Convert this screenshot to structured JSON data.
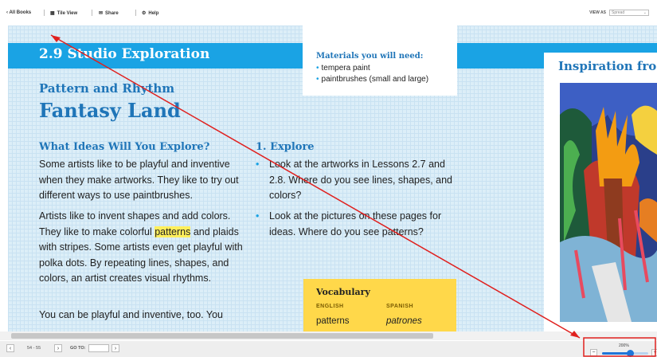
{
  "toolbar": {
    "all_books": "‹ All Books",
    "tile_view": "Tile View",
    "share": "Share",
    "help": "Help",
    "view_as_label": "VIEW AS",
    "view_as_value": "Spread"
  },
  "page": {
    "banner_title": "2.9 Studio Exploration",
    "materials_title": "Materials you will need:",
    "materials": [
      "tempera paint",
      "paintbrushes (small and large)"
    ],
    "subtitle": "Pattern and Rhythm",
    "title": "Fantasy Land",
    "ideas_heading": "What Ideas Will You Explore?",
    "para1": "Some artists like to be playful and inventive when they make artworks. They like to try out different ways to use paintbrushes.",
    "para2_a": "Artists like to invent shapes and add colors. They like to make colorful ",
    "para2_hl": "patterns",
    "para2_b": " and plaids with stripes. Some artists even get playful with polka dots. By repeating lines, shapes, and colors, an artist creates visual rhythms.",
    "para3": "You can be playful and inventive, too. You",
    "explore_heading": "1. Explore",
    "explore_items": [
      "Look at the artworks in Lessons 2.7 and 2.8. Where do you see lines, shapes, and colors?",
      "Look at the pictures on these pages for ideas. Where do you see patterns?"
    ],
    "vocab_title": "Vocabulary",
    "vocab_english_h": "ENGLISH",
    "vocab_spanish_h": "SPANISH",
    "vocab_english": "patterns",
    "vocab_spanish": "patrones",
    "inspiration_title": "Inspiration fro"
  },
  "footer": {
    "pages": "54 - 55",
    "goto_label": "GO TO:",
    "goto_value": "",
    "zoom_label": "200%",
    "zoom_level": 0.6
  },
  "colors": {
    "banner": "#1aa3e4",
    "heading": "#1f75b8",
    "vocab_bg": "#ffd84a",
    "annotation": "#e0201e"
  }
}
